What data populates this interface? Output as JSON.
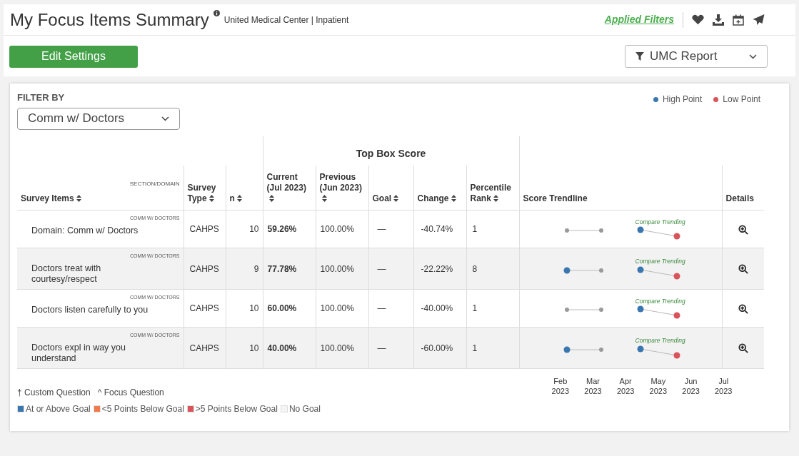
{
  "header": {
    "title": "My Focus Items Summary",
    "subtitle": "United Medical Center | Inpatient",
    "applied_filters": "Applied Filters"
  },
  "edit_button": "Edit Settings",
  "report_select": {
    "value": "UMC Report"
  },
  "filter": {
    "label": "FILTER BY",
    "value": "Comm w/ Doctors"
  },
  "legend": [
    {
      "label": "High Point",
      "color": "#3a76b0"
    },
    {
      "label": "Low Point",
      "color": "#d9545a"
    }
  ],
  "table": {
    "group_header": "Top Box Score",
    "section_label": "SECTION/DOMAIN",
    "columns": [
      {
        "label": "Survey Items",
        "sortable": true
      },
      {
        "label": "Survey Type",
        "sortable": true
      },
      {
        "label": "n",
        "sortable": true
      },
      {
        "label": "Current (Jul 2023)",
        "sortable": true
      },
      {
        "label": "Previous (Jun 2023)",
        "sortable": true
      },
      {
        "label": "Goal",
        "sortable": true
      },
      {
        "label": "Change",
        "sortable": true
      },
      {
        "label": "Percentile Rank",
        "sortable": true
      },
      {
        "label": "Score Trendline",
        "sortable": false
      },
      {
        "label": "Details",
        "sortable": false
      }
    ],
    "rows": [
      {
        "section": "COMM W/ DOCTORS",
        "item": "Domain: Comm w/ Doctors",
        "type": "CAHPS",
        "n": "10",
        "current": "59.26%",
        "previous": "100.00%",
        "goal": "—",
        "change": "-40.74%",
        "rank": "1",
        "first_is_high": false,
        "compare": "Compare Trending"
      },
      {
        "section": "COMM W/ DOCTORS",
        "item": "Doctors treat with courtesy/respect",
        "type": "CAHPS",
        "n": "9",
        "current": "77.78%",
        "previous": "100.00%",
        "goal": "—",
        "change": "-22.22%",
        "rank": "8",
        "first_is_high": true,
        "compare": "Compare Trending"
      },
      {
        "section": "COMM W/ DOCTORS",
        "item": "Doctors listen carefully to you",
        "type": "CAHPS",
        "n": "10",
        "current": "60.00%",
        "previous": "100.00%",
        "goal": "—",
        "change": "-40.00%",
        "rank": "1",
        "first_is_high": false,
        "compare": "Compare Trending"
      },
      {
        "section": "COMM W/ DOCTORS",
        "item": "Doctors expl in way you understand",
        "type": "CAHPS",
        "n": "10",
        "current": "40.00%",
        "previous": "100.00%",
        "goal": "—",
        "change": "-60.00%",
        "rank": "1",
        "first_is_high": true,
        "compare": "Compare Trending"
      }
    ],
    "months": [
      {
        "month": "Feb",
        "year": "2023"
      },
      {
        "month": "Mar",
        "year": "2023"
      },
      {
        "month": "Apr",
        "year": "2023"
      },
      {
        "month": "May",
        "year": "2023"
      },
      {
        "month": "Jun",
        "year": "2023"
      },
      {
        "month": "Jul",
        "year": "2023"
      }
    ]
  },
  "notes": [
    "† Custom Question",
    "^ Focus Question"
  ],
  "goal_legend": [
    {
      "label": "At or Above Goal",
      "color": "#3a76b0"
    },
    {
      "label": "<5 Points Below Goal",
      "color": "#f07a4a"
    },
    {
      "label": ">5 Points Below Goal",
      "color": "#d9545a"
    },
    {
      "label": "No Goal",
      "color": "#f4f4f4"
    }
  ]
}
